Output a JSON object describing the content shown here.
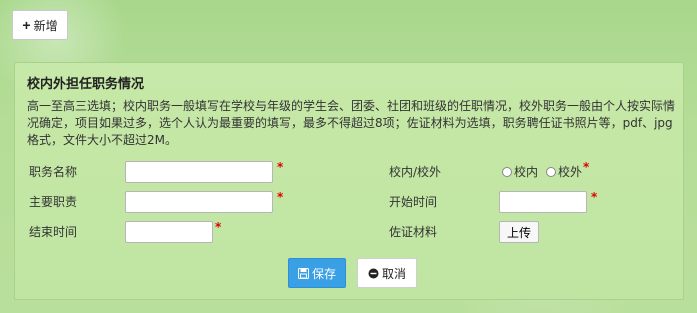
{
  "toolbar": {
    "add_label": "新增",
    "add_icon": "plus-icon"
  },
  "panel": {
    "title": "校内外担任职务情况",
    "description": "高一至高三选填；校内职务一般填写在学校与年级的学生会、团委、社团和班级的任职情况，校外职务一般由个人按实际情况确定，项目如果过多，选个人认为最重要的填写，最多不得超过8项；佐证材料为选填，职务聘任证书照片等，pdf、jpg格式，文件大小不超过2M。"
  },
  "form": {
    "position_name": {
      "label": "职务名称",
      "value": "",
      "required_mark": "*"
    },
    "scope": {
      "label": "校内/校外",
      "options": [
        "校内",
        "校外"
      ],
      "selected": "",
      "required_mark": "*"
    },
    "main_duty": {
      "label": "主要职责",
      "value": "",
      "required_mark": "*"
    },
    "start_time": {
      "label": "开始时间",
      "value": "",
      "required_mark": "*"
    },
    "end_time": {
      "label": "结束时间",
      "value": "",
      "required_mark": "*"
    },
    "evidence": {
      "label": "佐证材料",
      "upload_label": "上传"
    }
  },
  "actions": {
    "save_label": "保存",
    "save_icon": "save-icon",
    "cancel_label": "取消",
    "cancel_icon": "cancel-icon"
  },
  "colors": {
    "background": "#b5dd97",
    "panel": "#c3e6a5",
    "primary": "#3aa0e5",
    "required": "#e00000"
  }
}
